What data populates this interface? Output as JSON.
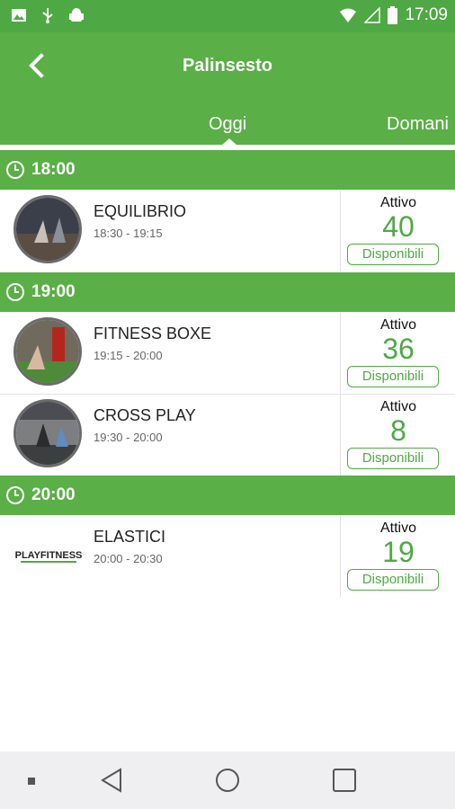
{
  "status_bar": {
    "time": "17:09"
  },
  "header": {
    "title": "Palinsesto"
  },
  "tabs": [
    {
      "label": "Oggi",
      "selected": true
    },
    {
      "label": "Domani",
      "selected": false
    }
  ],
  "groups": [
    {
      "time": "18:00",
      "classes": [
        {
          "name": "EQUILIBRIO",
          "hours": "18:30  -  19:15",
          "status": "Attivo",
          "count": "40",
          "action": "Disponibili"
        }
      ]
    },
    {
      "time": "19:00",
      "classes": [
        {
          "name": "FITNESS BOXE",
          "hours": "19:15  -  20:00",
          "status": "Attivo",
          "count": "36",
          "action": "Disponibili"
        },
        {
          "name": "CROSS PLAY",
          "hours": "19:30  -  20:00",
          "status": "Attivo",
          "count": "8",
          "action": "Disponibili"
        }
      ]
    },
    {
      "time": "20:00",
      "classes": [
        {
          "name": "ELASTICI",
          "hours": "20:00  -  20:30",
          "status": "Attivo",
          "count": "19",
          "action": "Disponibili",
          "logo_text": "PLAYFITNESS"
        }
      ]
    }
  ],
  "colors": {
    "primary": "#5aaf47",
    "accent": "#4ea944"
  }
}
